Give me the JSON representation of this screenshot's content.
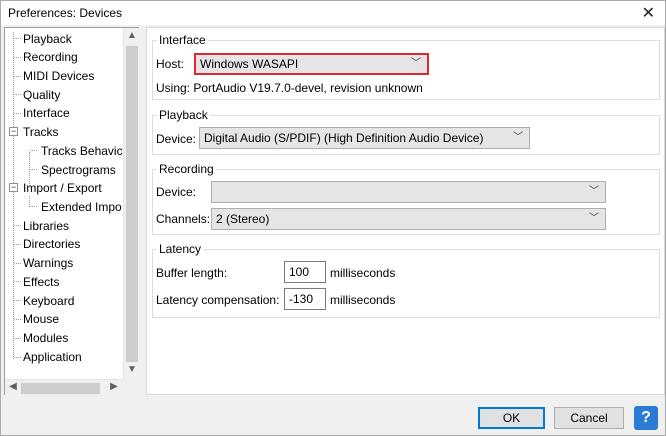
{
  "window": {
    "title": "Preferences: Devices",
    "close_glyph": "✕"
  },
  "tree": {
    "items": [
      {
        "label": "Playback"
      },
      {
        "label": "Recording"
      },
      {
        "label": "MIDI Devices"
      },
      {
        "label": "Quality"
      },
      {
        "label": "Interface"
      },
      {
        "label": "Tracks"
      },
      {
        "label": "Tracks Behavic"
      },
      {
        "label": "Spectrograms"
      },
      {
        "label": "Import / Export"
      },
      {
        "label": "Extended Impo"
      },
      {
        "label": "Libraries"
      },
      {
        "label": "Directories"
      },
      {
        "label": "Warnings"
      },
      {
        "label": "Effects"
      },
      {
        "label": "Keyboard"
      },
      {
        "label": "Mouse"
      },
      {
        "label": "Modules"
      },
      {
        "label": "Application"
      }
    ],
    "expander_glyph": "−"
  },
  "interface": {
    "title": "Interface",
    "host_label": "Host:",
    "host_value": "Windows WASAPI",
    "using_text": "Using: PortAudio V19.7.0-devel, revision unknown"
  },
  "playback": {
    "title": "Playback",
    "device_label": "Device:",
    "device_value": "Digital Audio (S/PDIF) (High Definition Audio Device)"
  },
  "recording": {
    "title": "Recording",
    "device_label": "Device:",
    "device_value": "",
    "channels_label": "Channels:",
    "channels_value": "2 (Stereo)"
  },
  "latency": {
    "title": "Latency",
    "buffer_label": "Buffer length:",
    "buffer_value": "100",
    "buffer_unit": "milliseconds",
    "comp_label": "Latency compensation:",
    "comp_value": "-130",
    "comp_unit": "milliseconds"
  },
  "buttons": {
    "ok": "OK",
    "cancel": "Cancel",
    "help": "?"
  },
  "icons": {
    "chevron": "﹀",
    "scroll_up": "▲",
    "scroll_down": "▼",
    "scroll_left": "◀",
    "scroll_right": "▶"
  },
  "colors": {
    "highlight_border": "#e0282e",
    "ok_border": "#0078d7",
    "help_bg": "#2a7ad6"
  }
}
